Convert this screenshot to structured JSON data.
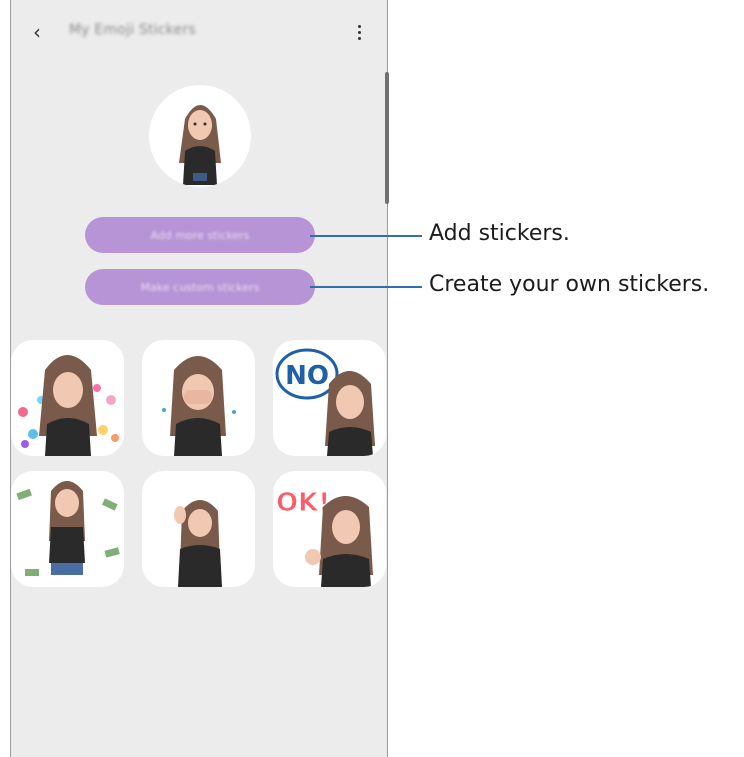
{
  "app_bar": {
    "back_glyph": "‹",
    "title": "My Emoji Stickers"
  },
  "buttons": {
    "add_more": "Add more stickers",
    "make_custom": "Make custom stickers"
  },
  "callouts": {
    "add": "Add stickers.",
    "create": "Create your own stickers."
  },
  "stickers": {
    "no_text": "NO",
    "ok_text": "OK!"
  },
  "colors": {
    "accent_purple": "#b794d6",
    "callout_line": "#2f6fae",
    "screen_bg": "#ececec"
  },
  "icons": [
    "back-icon",
    "more-options-icon"
  ]
}
